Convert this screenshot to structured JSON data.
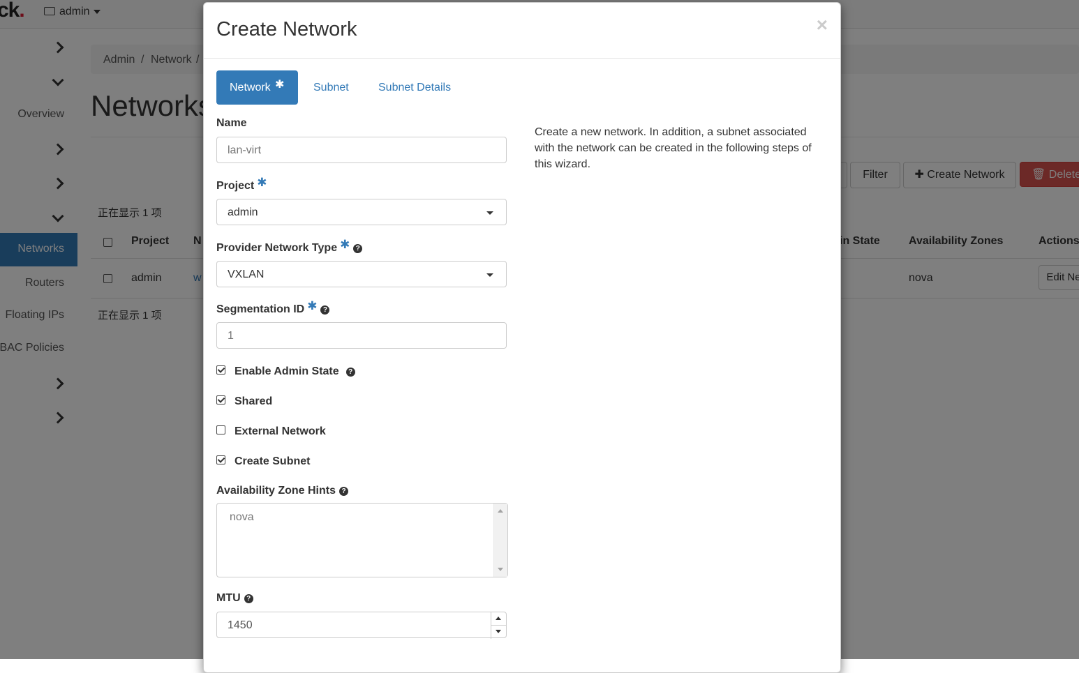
{
  "header": {
    "logo_text": "ck",
    "project_menu_label": "admin"
  },
  "sidebar": {
    "items": [
      {
        "label": "Overview"
      },
      {
        "label": "Networks"
      },
      {
        "label": "Routers"
      },
      {
        "label": "Floating IPs"
      },
      {
        "label": "BAC Policies"
      }
    ]
  },
  "breadcrumb": [
    "Admin",
    "/",
    "Network",
    "/"
  ],
  "page": {
    "title": "Networks",
    "count_top": "正在显示 1 项",
    "count_bottom": "正在显示 1 项",
    "buttons": {
      "filter": "Filter",
      "create": "Create Network",
      "delete": "Delete"
    },
    "table": {
      "headers": [
        "Project",
        "N",
        "in State",
        "Availability Zones",
        "Actions"
      ],
      "rows": [
        {
          "project": "admin",
          "name": "w",
          "zones": "nova",
          "action": "Edit Ne"
        }
      ]
    }
  },
  "modal": {
    "title": "Create Network",
    "close_symbol": "×",
    "tabs": [
      {
        "label": "Network",
        "active": true,
        "required_mark": "✱"
      },
      {
        "label": "Subnet"
      },
      {
        "label": "Subnet Details"
      }
    ],
    "fields": {
      "name_label": "Name",
      "name_value": "lan-virt",
      "project_label": "Project",
      "project_value": "admin",
      "provider_type_label": "Provider Network Type",
      "provider_type_value": "VXLAN",
      "segmentation_label": "Segmentation ID",
      "segmentation_value": "1",
      "admin_state_label": "Enable Admin State",
      "admin_state_checked": true,
      "shared_label": "Shared",
      "shared_checked": true,
      "external_label": "External Network",
      "external_checked": false,
      "create_subnet_label": "Create Subnet",
      "create_subnet_checked": true,
      "az_hints_label": "Availability Zone Hints",
      "az_hints_value": "nova",
      "mtu_label": "MTU",
      "mtu_value": "1450"
    },
    "required_mark": "✱",
    "help_symbol": "?",
    "description": "Create a new network. In addition, a subnet associated with the network can be created in the following steps of this wizard."
  }
}
